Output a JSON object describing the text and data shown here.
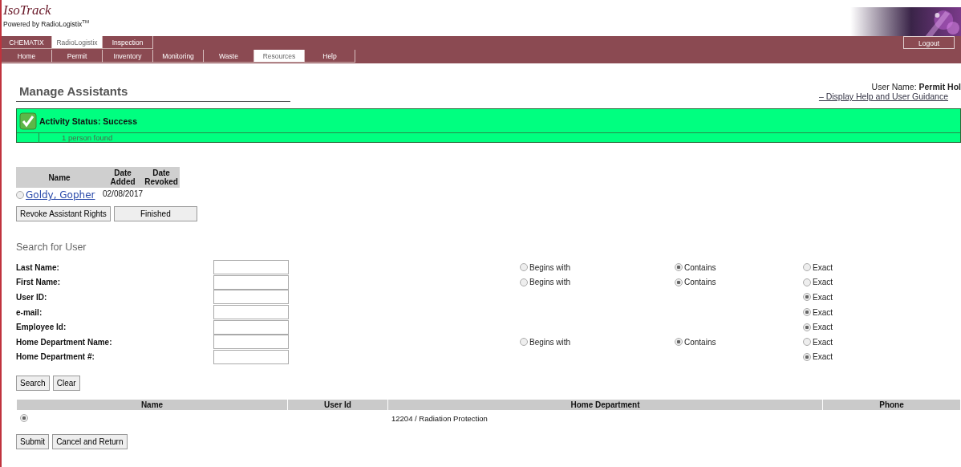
{
  "header": {
    "logo": "IsoTrack",
    "tagline": "Powered by RadioLogistix",
    "tagline_mark": "TM"
  },
  "module_tabs": [
    {
      "label": "CHEMATIX",
      "selected": false
    },
    {
      "label": "RadioLogistix",
      "selected": true
    },
    {
      "label": "Inspection",
      "selected": false
    }
  ],
  "logout": "Logout",
  "nav_tabs": [
    {
      "label": "Home",
      "selected": false
    },
    {
      "label": "Permit",
      "selected": false
    },
    {
      "label": "Inventory",
      "selected": false
    },
    {
      "label": "Monitoring",
      "selected": false
    },
    {
      "label": "Waste",
      "selected": false
    },
    {
      "label": "Resources",
      "selected": true
    },
    {
      "label": "Help",
      "selected": false
    }
  ],
  "page_title": "Manage Assistants",
  "user_name": "User Name: **Permit Hol**",
  "help_link": "– Display Help and User Guidance",
  "status": {
    "kind": "success",
    "title": "Activity Status: Success",
    "message": "1 person found"
  },
  "assistants": {
    "columns": [
      "Name",
      "Date Added",
      "Date Revoked"
    ],
    "rows": [
      {
        "selected": false,
        "name": "Goldy, Gopher",
        "date_added": "02/08/2017"
      }
    ]
  },
  "assistant_buttons": [
    "Revoke Assistant Rights",
    "Finished"
  ],
  "search": {
    "title": "Search for User",
    "fields": [
      {
        "label": "Last Name:",
        "options": [
          {
            "kind": "begins",
            "label": "Begins with",
            "selected": false
          },
          {
            "kind": "contains",
            "label": "Contains",
            "selected": true
          },
          {
            "kind": "exact",
            "label": "Exact",
            "selected": false
          }
        ]
      },
      {
        "label": "First Name:",
        "options": [
          {
            "kind": "begins",
            "label": "Begins with",
            "selected": false
          },
          {
            "kind": "contains",
            "label": "Contains",
            "selected": true
          },
          {
            "kind": "exact",
            "label": "Exact",
            "selected": false
          }
        ]
      },
      {
        "label": "User ID:",
        "options": [
          {
            "kind": "exact",
            "label": "Exact",
            "selected": true
          }
        ]
      },
      {
        "label": "e-mail:",
        "options": [
          {
            "kind": "exact",
            "label": "Exact",
            "selected": true
          }
        ]
      },
      {
        "label": "Employee Id:",
        "options": [
          {
            "kind": "exact",
            "label": "Exact",
            "selected": true
          }
        ]
      },
      {
        "label": "Home Department Name:",
        "options": [
          {
            "kind": "begins",
            "label": "Begins with",
            "selected": false
          },
          {
            "kind": "contains",
            "label": "Contains",
            "selected": true
          },
          {
            "kind": "exact",
            "label": "Exact",
            "selected": false
          }
        ]
      },
      {
        "label": "Home Department #:",
        "options": [
          {
            "kind": "exact",
            "label": "Exact",
            "selected": true
          }
        ]
      }
    ],
    "buttons": [
      "Search",
      "Clear"
    ]
  },
  "results": {
    "columns": [
      "Name",
      "User Id",
      "Home Department",
      "Phone"
    ],
    "rows": [
      {
        "selected": true,
        "home_department": "12204 / Radiation Protection"
      }
    ]
  },
  "footer_buttons": [
    "Submit",
    "Cancel and Return"
  ]
}
